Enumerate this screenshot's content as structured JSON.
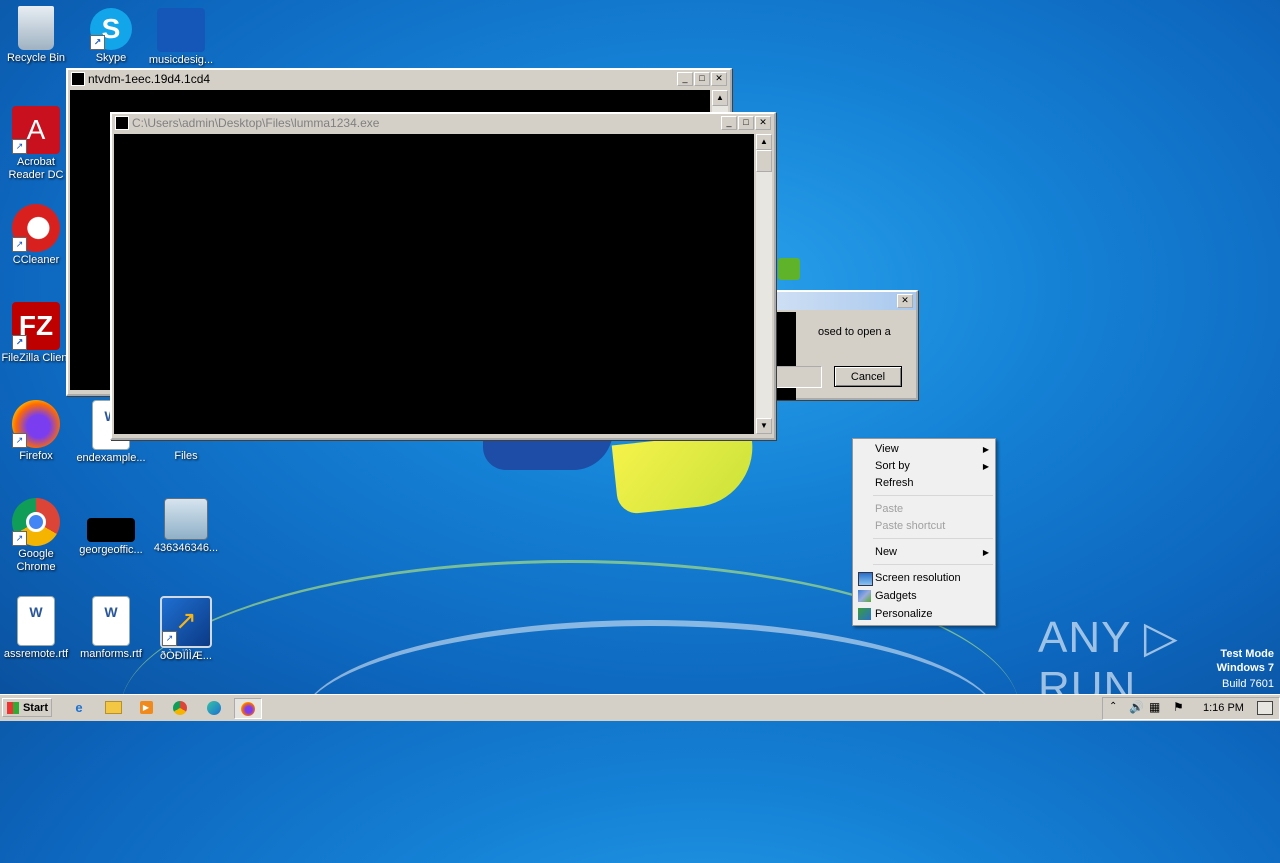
{
  "desktop_icons": [
    {
      "label": "Recycle Bin"
    },
    {
      "label": "Skype"
    },
    {
      "label": "musicdesig..."
    },
    {
      "label": "Acrobat Reader DC"
    },
    {
      "label": "CCleaner"
    },
    {
      "label": "FileZilla Client"
    },
    {
      "label": "Firefox"
    },
    {
      "label": "endexample..."
    },
    {
      "label": "Files"
    },
    {
      "label": "Google Chrome"
    },
    {
      "label": "georgeoffic..."
    },
    {
      "label": "436346346..."
    },
    {
      "label": "assremote.rtf"
    },
    {
      "label": "manforms.rtf"
    },
    {
      "label": "ðÒÐÏÌÌÆ..."
    }
  ],
  "windows": {
    "ntvdm": {
      "title": "ntvdm-1eec.19d4.1cd4"
    },
    "lumma": {
      "title": "C:\\Users\\admin\\Desktop\\Files\\lumma1234.exe"
    },
    "dialog": {
      "text": "osed to open a",
      "cancel_label": "Cancel"
    }
  },
  "context_menu": {
    "items": [
      {
        "label": "View",
        "submenu": true,
        "disabled": false
      },
      {
        "label": "Sort by",
        "submenu": true,
        "disabled": false
      },
      {
        "label": "Refresh",
        "submenu": false,
        "disabled": false
      },
      {
        "label": "Paste",
        "submenu": false,
        "disabled": true
      },
      {
        "label": "Paste shortcut",
        "submenu": false,
        "disabled": true
      },
      {
        "label": "New",
        "submenu": true,
        "disabled": false
      },
      {
        "label": "Screen resolution",
        "icon": "monitor-icon"
      },
      {
        "label": "Gadgets",
        "icon": "gadgets-icon"
      },
      {
        "label": "Personalize",
        "icon": "personalize-icon"
      }
    ]
  },
  "taskbar": {
    "start_label": "Start",
    "clock": "1:16 PM",
    "pinned": [
      "internet-explorer-icon",
      "explorer-icon",
      "media-player-icon",
      "chrome-icon",
      "edge-icon",
      "firefox-icon"
    ]
  },
  "watermark": {
    "brand": "ANY ▷ RUN",
    "line1": "Test Mode",
    "line2": "Windows 7",
    "line3": "Build 7601"
  }
}
